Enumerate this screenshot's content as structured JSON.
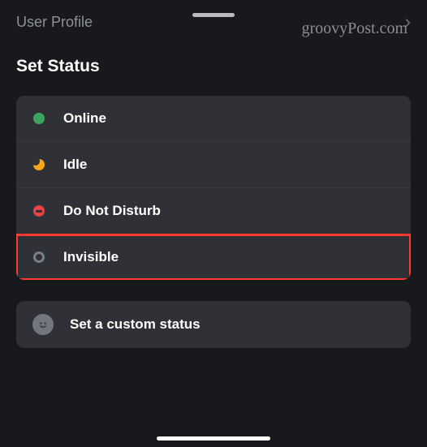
{
  "header": {
    "back_label": "User Profile"
  },
  "section": {
    "title": "Set Status"
  },
  "statuses": [
    {
      "key": "online",
      "label": "Online"
    },
    {
      "key": "idle",
      "label": "Idle"
    },
    {
      "key": "dnd",
      "label": "Do Not Disturb"
    },
    {
      "key": "invisible",
      "label": "Invisible"
    }
  ],
  "highlighted_status": "invisible",
  "custom": {
    "label": "Set a custom status"
  },
  "watermark": "groovyPost.com"
}
